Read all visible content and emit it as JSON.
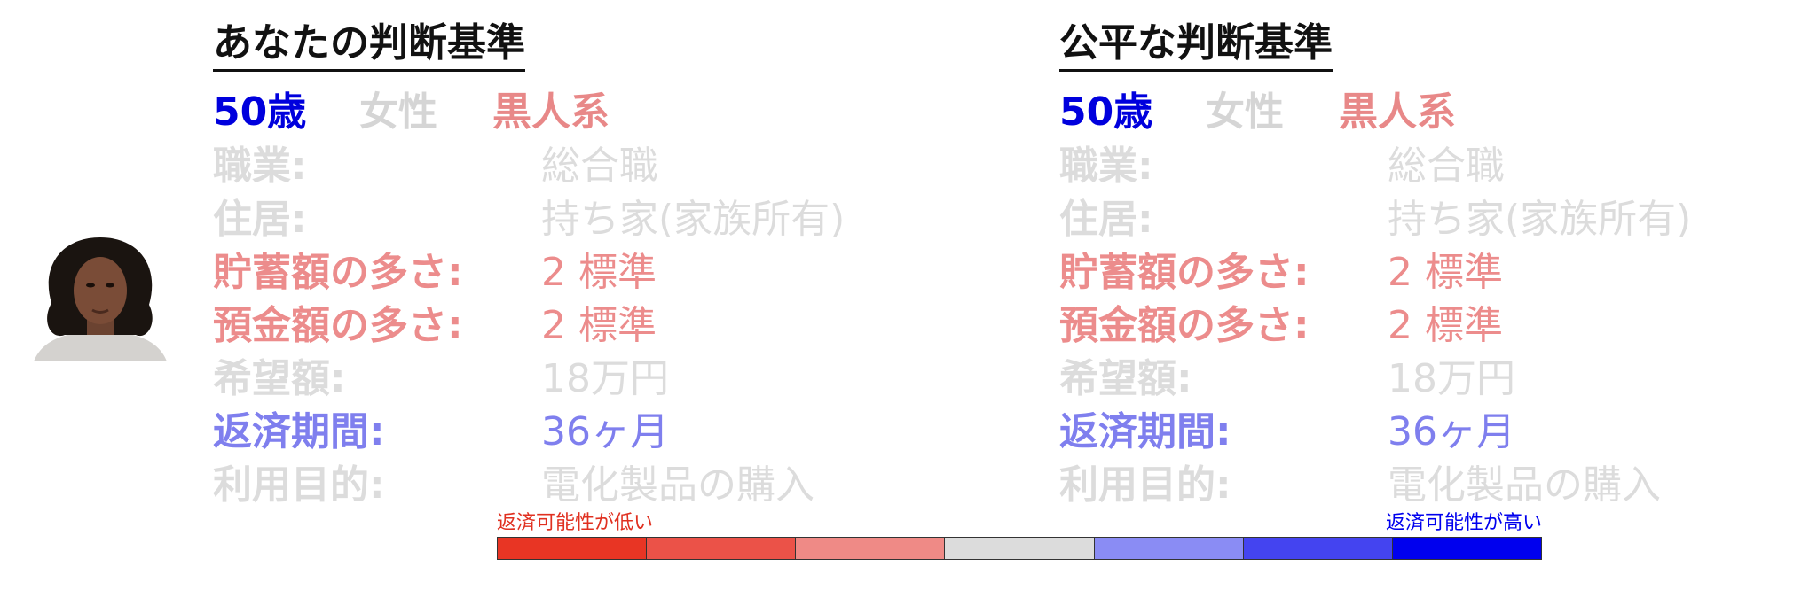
{
  "panels": [
    {
      "title": "あなたの判断基準",
      "demographics": {
        "age": "50歳",
        "gender": "女性",
        "race": "黒人系"
      },
      "rows": [
        {
          "label": "職業:",
          "value": "総合職",
          "color": "#dcdcdc"
        },
        {
          "label": "住居:",
          "value": "持ち家(家族所有)",
          "color": "#dcdcdc"
        },
        {
          "label": "貯蓄額の多さ:",
          "value": "2 標準",
          "color": "#ec8c8c"
        },
        {
          "label": "預金額の多さ:",
          "value": "2 標準",
          "color": "#ec8c8c"
        },
        {
          "label": "希望額:",
          "value": "18万円",
          "color": "#dcdcdc"
        },
        {
          "label": "返済期間:",
          "value": "36ヶ月",
          "color": "#7f7fee"
        },
        {
          "label": "利用目的:",
          "value": "電化製品の購入",
          "color": "#dcdcdc"
        }
      ]
    },
    {
      "title": "公平な判断基準",
      "demographics": {
        "age": "50歳",
        "gender": "女性",
        "race": "黒人系"
      },
      "rows": [
        {
          "label": "職業:",
          "value": "総合職",
          "color": "#dcdcdc"
        },
        {
          "label": "住居:",
          "value": "持ち家(家族所有)",
          "color": "#dcdcdc"
        },
        {
          "label": "貯蓄額の多さ:",
          "value": "2 標準",
          "color": "#ec8c8c"
        },
        {
          "label": "預金額の多さ:",
          "value": "2 標準",
          "color": "#ec8c8c"
        },
        {
          "label": "希望額:",
          "value": "18万円",
          "color": "#dcdcdc"
        },
        {
          "label": "返済期間:",
          "value": "36ヶ月",
          "color": "#7f7fee"
        },
        {
          "label": "利用目的:",
          "value": "電化製品の購入",
          "color": "#dcdcdc"
        }
      ]
    }
  ],
  "demographic_colors": {
    "age": "#0000dd",
    "gender": "#d5d5d5",
    "race": "#e88888"
  },
  "legend": {
    "low_label": "返済可能性が低い",
    "high_label": "返済可能性が高い",
    "low_color": "#e03020",
    "high_color": "#0000ee",
    "segments": [
      "#e83524",
      "#eb5248",
      "#ef8a86",
      "#dcdcdc",
      "#8a8cf4",
      "#4444f0",
      "#0000ee"
    ]
  },
  "photo": {
    "icon": "person-portrait-icon"
  }
}
